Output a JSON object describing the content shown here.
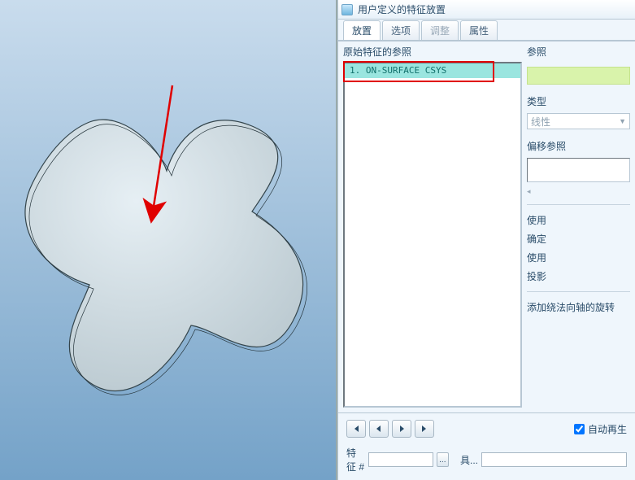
{
  "panel": {
    "title": "用户定义的特征放置",
    "tabs": {
      "placement": "放置",
      "options": "选项",
      "adjust": "调整",
      "attributes": "属性"
    },
    "sections": {
      "original_refs": "原始特征的参照",
      "refs": "参照",
      "type": "类型",
      "type_value": "线性",
      "offset_refs": "偏移参照",
      "use1": "使用",
      "confirm": "确定",
      "use2": "使用",
      "projection": "投影",
      "add_rotation": "添加绕法向轴的旋转"
    },
    "list": {
      "item1": "1. ON-SURFACE CSYS"
    },
    "bottom": {
      "auto_regen": "自动再生",
      "feat_num_label": "特征 #",
      "feat_num_value": "",
      "detail_label": "具...",
      "ellipsis": "..."
    },
    "icons": {
      "first": "first-icon",
      "prev": "prev-icon",
      "next": "next-icon",
      "last": "last-icon"
    }
  }
}
